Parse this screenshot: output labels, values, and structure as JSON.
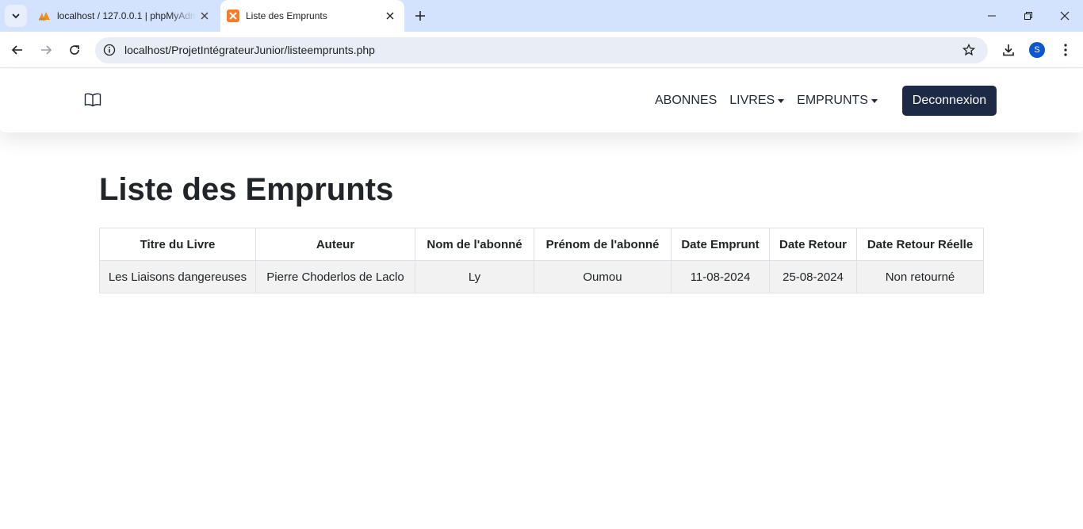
{
  "browser": {
    "tabs": [
      {
        "title": "localhost / 127.0.0.1 | phpMyAdmin",
        "favicon": "phpmyadmin-icon",
        "active": false
      },
      {
        "title": "Liste des Emprunts",
        "favicon": "xampp-icon",
        "active": true
      }
    ],
    "url": "localhost/ProjetIntégrateurJunior/listeemprunts.php",
    "profile_initial": "S"
  },
  "navbar": {
    "brand_icon": "book-icon",
    "links": [
      {
        "label": "ABONNES",
        "dropdown": false
      },
      {
        "label": "LIVRES",
        "dropdown": true
      },
      {
        "label": "EMPRUNTS",
        "dropdown": true
      }
    ],
    "logout_label": "Deconnexion",
    "logout_color": "#1c2a45"
  },
  "main": {
    "title": "Liste des Emprunts",
    "table": {
      "columns": [
        "Titre du Livre",
        "Auteur",
        "Nom de l'abonné",
        "Prénom de l'abonné",
        "Date Emprunt",
        "Date Retour",
        "Date Retour Réelle"
      ],
      "rows": [
        [
          "Les Liaisons dangereuses",
          "Pierre Choderlos de Laclo",
          "Ly",
          "Oumou",
          "11-08-2024",
          "25-08-2024",
          "Non retourné"
        ]
      ]
    }
  }
}
